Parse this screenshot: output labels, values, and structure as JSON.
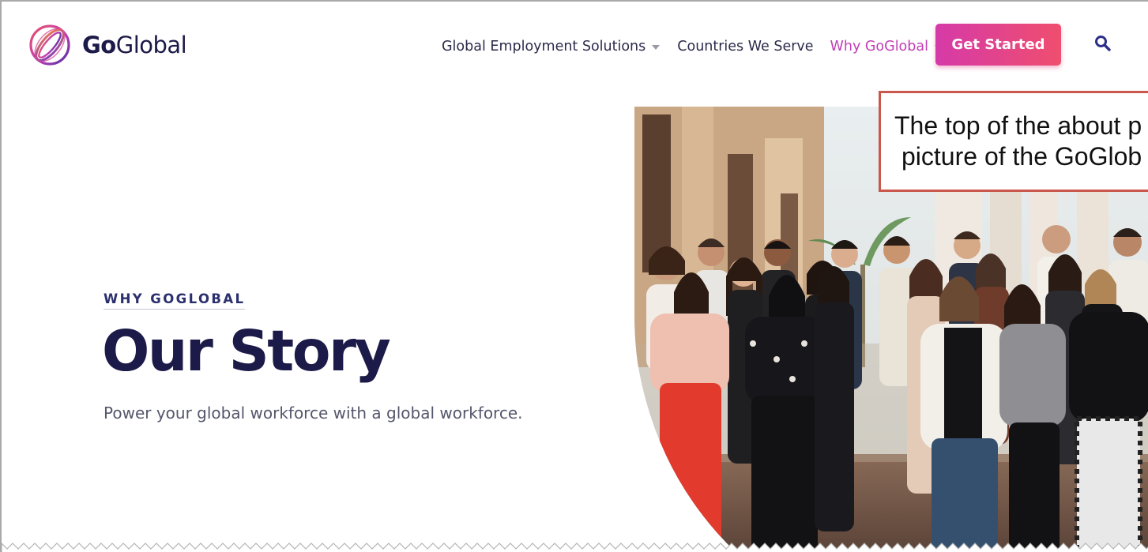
{
  "brand": {
    "name_bold": "Go",
    "name_light": "Global",
    "logo_icon": "globe-rings-icon",
    "gradient": [
      "#c23fb6",
      "#e8526b",
      "#4b2fa3"
    ]
  },
  "nav": {
    "items": [
      {
        "label": "Global Employment Solutions",
        "dropdown": true,
        "active": false
      },
      {
        "label": "Countries We Serve",
        "dropdown": false,
        "active": false
      },
      {
        "label": "Why GoGlobal",
        "dropdown": true,
        "active": true
      }
    ],
    "cta_label": "Get Started",
    "search_icon": "search-icon"
  },
  "hero": {
    "eyebrow": "WHY GOGLOBAL",
    "title": "Our Story",
    "subtitle": "Power your global workforce with a global workforce."
  },
  "photo": {
    "subject": "team-group-photo"
  },
  "callout": {
    "line1": "The top of the about p",
    "line2": "picture of the GoGlob"
  },
  "colors": {
    "navy": "#1c1a48",
    "accent_pink": "#c13fb5",
    "cta_start": "#d63aa8",
    "cta_end": "#ef4e6e",
    "callout_border": "#c9574b"
  }
}
